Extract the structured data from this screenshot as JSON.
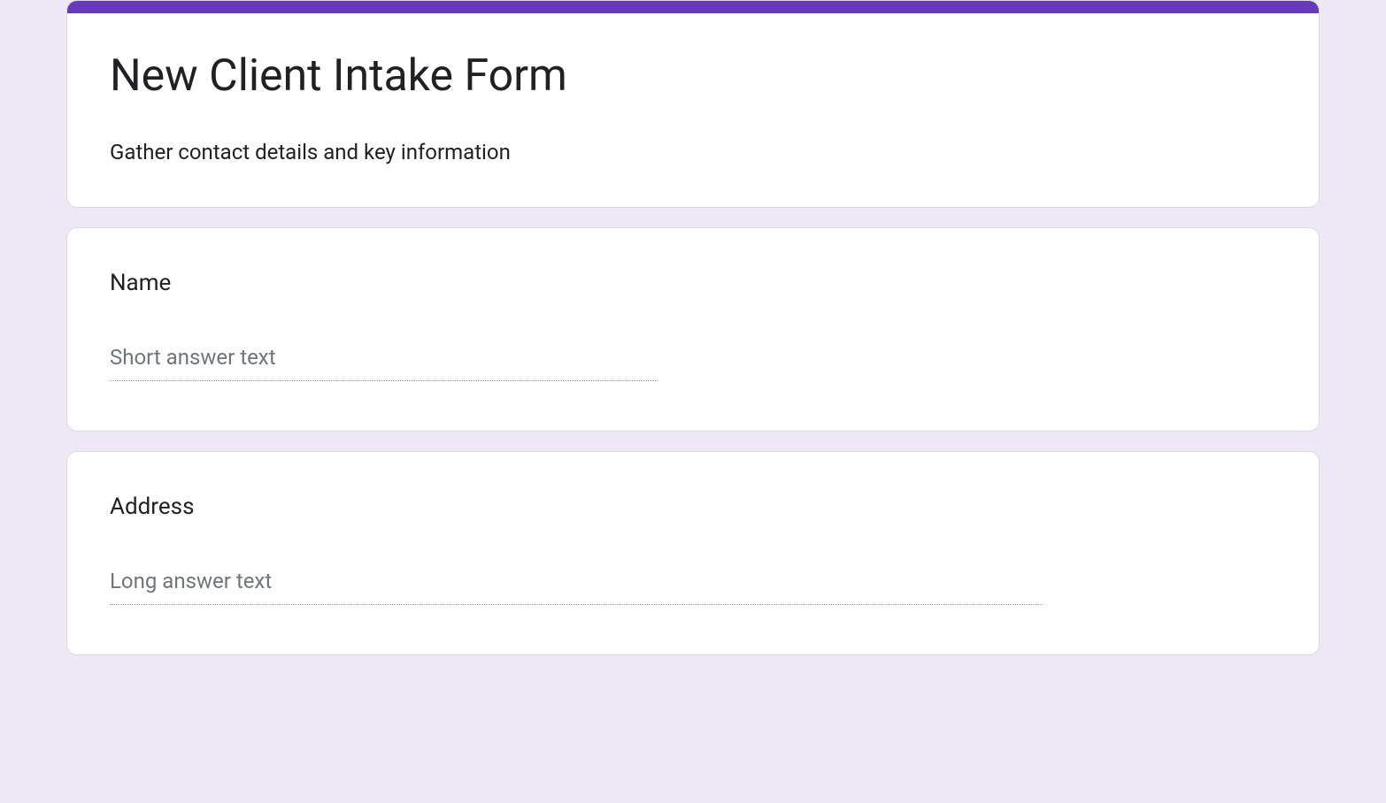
{
  "form": {
    "title": "New Client Intake Form",
    "description": "Gather contact details and key information",
    "accent_color": "#673ab7"
  },
  "questions": [
    {
      "title": "Name",
      "placeholder": "Short answer text",
      "type": "short"
    },
    {
      "title": "Address",
      "placeholder": "Long answer text",
      "type": "long"
    }
  ]
}
